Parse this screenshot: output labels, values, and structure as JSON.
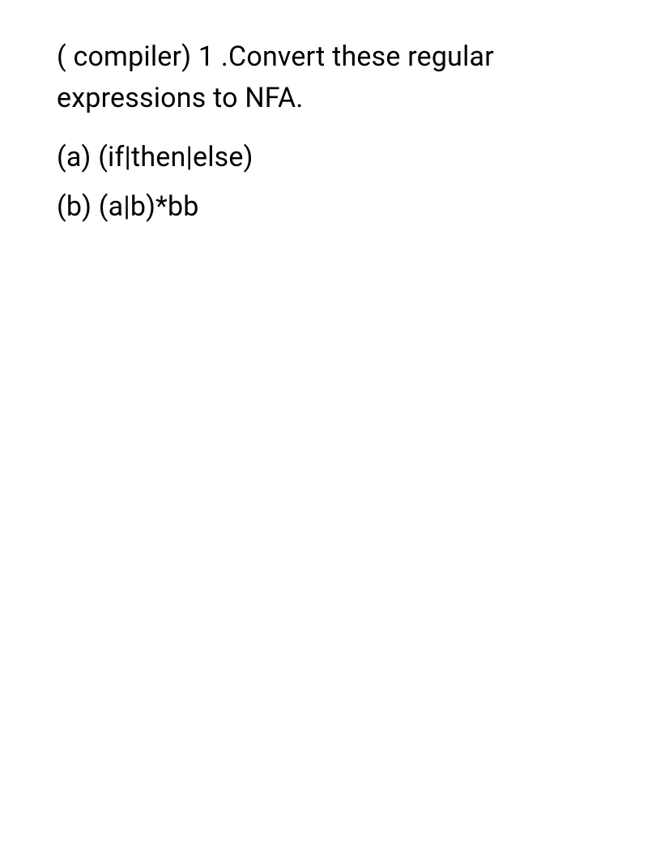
{
  "question": {
    "title": "( compiler) 1 .Convert these regular expressions to NFA.",
    "parts": {
      "a": "(a) (if|then|else)",
      "b": "(b) (a|b)*bb"
    }
  }
}
